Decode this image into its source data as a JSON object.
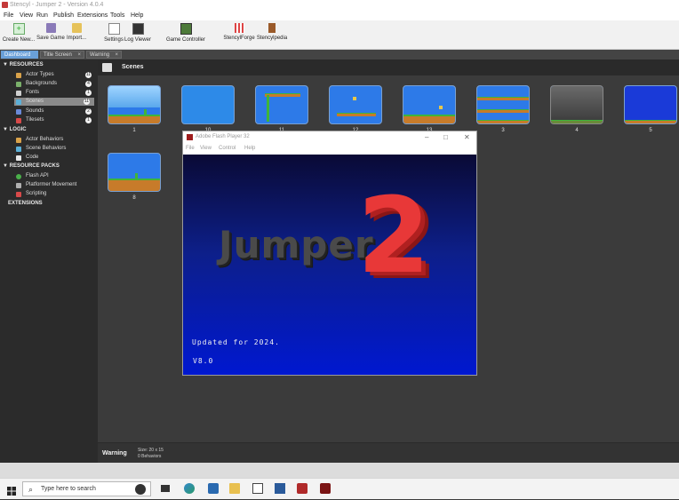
{
  "window": {
    "title": "Stencyl - Jumper 2 - Version 4.0.4"
  },
  "menu": [
    "File",
    "View",
    "Run",
    "Publish",
    "Extensions",
    "Tools",
    "Help"
  ],
  "toolbar": [
    "Create New...",
    "Save Game",
    "Import...",
    "Settings",
    "Log Viewer",
    "Game Controller",
    "StencylForge",
    "Stencylpedia"
  ],
  "tabs": [
    "Dashboard",
    "Title Screen",
    "Warning"
  ],
  "sidebar": {
    "resources_header": "RESOURCES",
    "resources": [
      {
        "label": "Actor Types",
        "count": "11",
        "icon": "actor-icon"
      },
      {
        "label": "Backgrounds",
        "count": "4",
        "icon": "background-icon"
      },
      {
        "label": "Fonts",
        "count": "1",
        "icon": "font-icon"
      },
      {
        "label": "Scenes",
        "count": "11",
        "icon": "scene-icon"
      },
      {
        "label": "Sounds",
        "count": "2",
        "icon": "sound-icon"
      },
      {
        "label": "Tilesets",
        "count": "1",
        "icon": "tileset-icon"
      }
    ],
    "logic_header": "LOGIC",
    "logic": [
      "Actor Behaviors",
      "Scene Behaviors",
      "Code"
    ],
    "packs_header": "RESOURCE PACKS",
    "packs": [
      "Flash API",
      "Platformer Movement",
      "Scripting"
    ],
    "extensions_header": "EXTENSIONS"
  },
  "main": {
    "header": "Scenes",
    "scenes_row1": [
      "1",
      "10",
      "11",
      "12",
      "13",
      "3",
      "4",
      "5"
    ],
    "scenes_row2": [
      "8"
    ]
  },
  "statusbar": {
    "name": "Warning",
    "size": "Size: 20 x 15",
    "behaviors": "0 Behaviors"
  },
  "flash": {
    "title": "Adobe Flash Player 32",
    "menu": [
      "File",
      "View",
      "Control",
      "Help"
    ],
    "logo_word": "Jumper",
    "logo_number": "2",
    "updated": "Updated for 2024.",
    "version": "V8.0"
  },
  "taskbar": {
    "search_placeholder": "Type here to search"
  },
  "colors": {
    "accent_tab": "#6aa0d8",
    "flash_title_icon": "#9e1c1c",
    "logo_red": "#e83838"
  }
}
